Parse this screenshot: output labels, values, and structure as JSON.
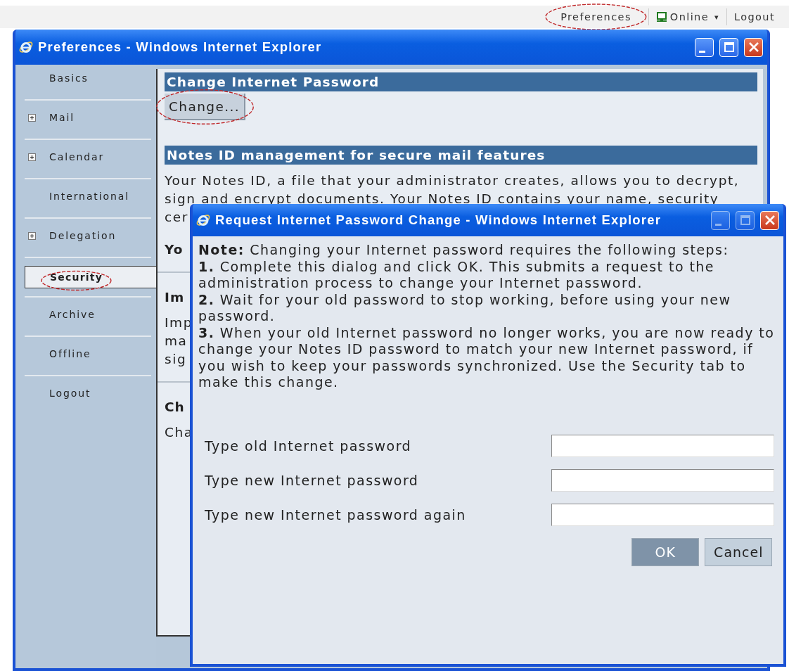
{
  "top_bar": {
    "items": [
      {
        "kind": "link",
        "label": "Preferences",
        "circled": true
      },
      {
        "kind": "status",
        "label": "Online",
        "caret": "▾",
        "circled": false
      },
      {
        "kind": "link",
        "label": "Logout",
        "circled": false
      }
    ]
  },
  "preferences_window": {
    "title": "Preferences - Windows Internet Explorer",
    "controls": [
      {
        "kind": "minimize",
        "disabled": false
      },
      {
        "kind": "maximize",
        "disabled": false
      },
      {
        "kind": "close",
        "disabled": false
      }
    ],
    "sidebar": {
      "items": [
        {
          "label": "Basics",
          "expandable": false,
          "selected": false,
          "circled": false
        },
        {
          "label": "Mail",
          "expandable": true,
          "selected": false,
          "circled": false
        },
        {
          "label": "Calendar",
          "expandable": true,
          "selected": false,
          "circled": false
        },
        {
          "label": "International",
          "expandable": false,
          "selected": false,
          "circled": false
        },
        {
          "label": "Delegation",
          "expandable": true,
          "selected": false,
          "circled": false
        },
        {
          "label": "Security",
          "expandable": false,
          "selected": true,
          "circled": true
        },
        {
          "label": "Archive",
          "expandable": false,
          "selected": false,
          "circled": false
        },
        {
          "label": "Offline",
          "expandable": false,
          "selected": false,
          "circled": false
        },
        {
          "label": "Logout",
          "expandable": false,
          "selected": false,
          "circled": false
        }
      ]
    },
    "content": {
      "blocks": [
        {
          "kind": "header",
          "text": "Change Internet Password"
        },
        {
          "kind": "button",
          "text": "Change...",
          "circled": true
        },
        {
          "kind": "header",
          "text": "Notes ID management for secure mail features"
        },
        {
          "kind": "paragraph",
          "lines": [
            "Your Notes ID, a file that your administrator creates, allows you to decrypt,",
            "sign and encrypt documents. Your Notes ID contains your name, security"
          ]
        },
        {
          "kind": "text",
          "text": "cer"
        },
        {
          "kind": "bold",
          "text": "Yo"
        },
        {
          "kind": "divider"
        },
        {
          "kind": "bold",
          "text": "Im"
        },
        {
          "kind": "text",
          "text": "Imp"
        },
        {
          "kind": "text",
          "text": "ma"
        },
        {
          "kind": "text",
          "text": "sig"
        },
        {
          "kind": "divider"
        },
        {
          "kind": "bold",
          "text": "Ch"
        },
        {
          "kind": "text",
          "text": "Cha"
        }
      ]
    }
  },
  "dialog": {
    "title": "Request Internet Password Change - Windows Internet Explorer",
    "controls": [
      {
        "kind": "minimize",
        "disabled": true
      },
      {
        "kind": "maximize",
        "disabled": true
      },
      {
        "kind": "close",
        "disabled": false
      }
    ],
    "paragraphs": [
      {
        "lines": [
          "**Note:** Changing your Internet password requires the following steps:"
        ]
      },
      {
        "lines": [
          "**1.** Complete this dialog and click OK. This submits a request to the",
          "administration process to change your Internet password."
        ]
      },
      {
        "lines": [
          "**2.** Wait for your old password to stop working, before using your new",
          "password."
        ]
      },
      {
        "lines": [
          "**3.** When your old Internet password no longer works, you are now ready to",
          "change your Notes ID password to match your new Internet password, if",
          "you wish to keep your passwords synchronized. Use the Security tab to",
          "make this change."
        ]
      }
    ],
    "fields": [
      {
        "label": "Type old Internet password"
      },
      {
        "label": "Type new Internet password"
      },
      {
        "label": "Type new Internet password again"
      }
    ],
    "buttons": [
      {
        "label": "OK",
        "disabled": true
      },
      {
        "label": "Cancel",
        "disabled": false
      }
    ]
  }
}
